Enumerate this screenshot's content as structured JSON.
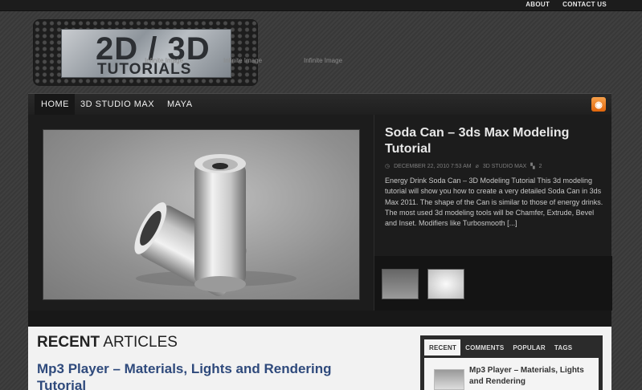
{
  "top_nav": [
    "ABOUT",
    "CONTACT US"
  ],
  "logo": {
    "line1": "2D / 3D",
    "line2": "TUTORIALS"
  },
  "infinite_image_labels": [
    "Infinite Image",
    "Infinite Image",
    "Infinite Image"
  ],
  "main_nav": [
    "HOME",
    "3D STUDIO MAX",
    "MAYA"
  ],
  "featured": {
    "title": "Soda Can – 3ds Max Modeling Tutorial",
    "date": "DECEMBER 22, 2010 7:53 AM",
    "category": "3D STUDIO MAX",
    "comments": "2",
    "excerpt": "Energy Drink Soda Can – 3D Modeling Tutorial This 3d modeling tutorial will show you how to create a very detailed Soda Can in 3ds Max 2011. The shape of the Can is similar to those of energy drinks. The most used 3d modeling tools will be Chamfer, Extrude, Bevel and Inset. Modifiers like Turbosmooth [...]"
  },
  "recent": {
    "heading_bold": "RECENT",
    "heading_rest": "ARTICLES",
    "first_post_title": "Mp3 Player – Materials, Lights and Rendering Tutorial"
  },
  "widget": {
    "tabs": [
      "RECENT",
      "COMMENTS",
      "POPULAR",
      "TAGS"
    ],
    "first_item": "Mp3 Player – Materials, Lights and Rendering"
  },
  "colors": {
    "link": "#2f4a7c",
    "rss": "#e2660b"
  }
}
